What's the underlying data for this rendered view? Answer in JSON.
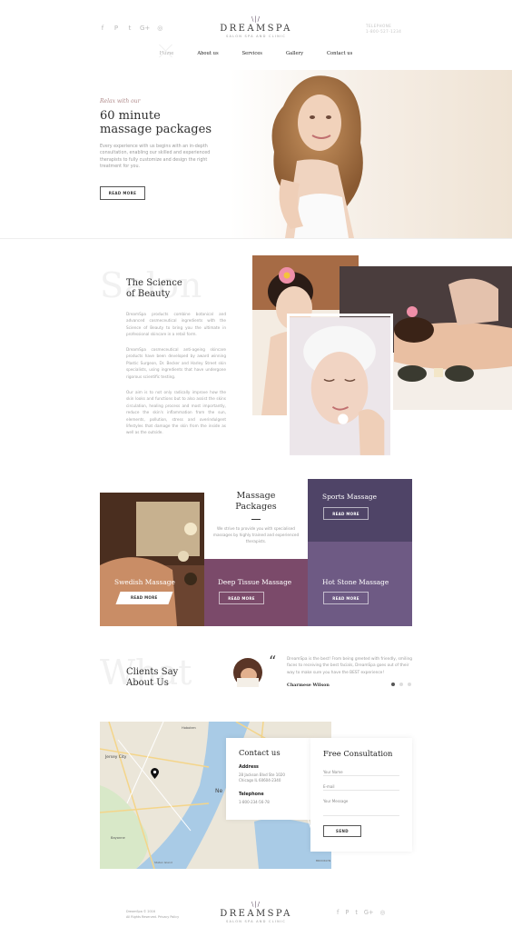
{
  "header": {
    "social": [
      "f",
      "P",
      "t",
      "G+",
      "◎"
    ],
    "logo": {
      "rays": "\\|/",
      "name": "DREAMSPA",
      "tagline": "SALON SPA AND CLINIC"
    },
    "phone": {
      "label": "TELEPHONE",
      "number": "1-800-527-1234"
    }
  },
  "nav": [
    {
      "label": "Home",
      "active": true
    },
    {
      "label": "About us",
      "active": false
    },
    {
      "label": "Services",
      "active": false
    },
    {
      "label": "Gallery",
      "active": false
    },
    {
      "label": "Contact us",
      "active": false
    }
  ],
  "hero": {
    "kicker": "Relax with our",
    "title_line1": "60 minute",
    "title_line2": "massage packages",
    "description": "Every experience with us begins with an in-depth consultation, enabling our skilled and experienced therapists to fully customize and design the right treatment for you.",
    "button": "READ MORE"
  },
  "science": {
    "bg_word": "Salon",
    "title_line1": "The Science",
    "title_line2": "of Beauty",
    "p1": "DreamSpa products combine botanical and advanced cosmeceutical ingredients with the Science of Beauty to bring you the ultimate in professional skincare in a retail form.",
    "p2": "DreamSpa cosmeceutical anti-ageing skincare products have been developed by award winning Plastic Surgeon, Dr. Becker and Harley Street skin specialists, using ingredients that have undergone rigorous scientific testing.",
    "p3": "Our aim is to not only radically improve how the skin looks and functions but to also assist the skins circulation, healing process and most importantly, reduce the skin's inflammation from the sun, elements, pollution, stress and overindulgent lifestyles that damage the skin from the inside as well as the outside."
  },
  "packages": {
    "title_line1": "Massage",
    "title_line2": "Packages",
    "description": "We strive to provide you with specialised massages by highly trained and experienced therapists.",
    "tiles": [
      {
        "name": "Swedish Massage",
        "button": "READ MORE"
      },
      {
        "name": "Sports Massage",
        "button": "READ MORE"
      },
      {
        "name": "Deep Tissue Massage",
        "button": "READ MORE"
      },
      {
        "name": "Hot Stone Massage",
        "button": "READ MORE"
      }
    ]
  },
  "testimonials": {
    "bg_word": "What",
    "title_line1": "Clients Say",
    "title_line2": "About Us",
    "quote_mark": "“",
    "quote": "DreamSpa is the best! From being greeted with friendly, smiling faces to receiving the best facials, DreamSpa goes out of their way to make sure you have the BEST experience!",
    "author": "Charmese Wilson"
  },
  "contact": {
    "title": "Contact us",
    "address_label": "Address",
    "address_line1": "28 Jackson Blvd Ste 1020",
    "address_line2": "Chicago IL 60604-2340",
    "phone_label": "Telephone",
    "phone": "1-800-234-56-78",
    "map_labels": [
      "Jersey City",
      "Hoboken",
      "Ne",
      "Bayonne",
      "BROOKLYN",
      "Staten Island"
    ]
  },
  "consultation": {
    "title": "Free Consultation",
    "name_placeholder": "Your Name",
    "email_placeholder": "E-mail",
    "message_placeholder": "Your Message",
    "send": "SEND"
  },
  "footer": {
    "copyright": "DreamSpa © 2016",
    "links": "All Rights Reserved. Privacy Policy",
    "social": [
      "f",
      "P",
      "t",
      "G+",
      "◎"
    ]
  },
  "colors": {
    "sports": "#4f4467",
    "deep": "#7b4a6a",
    "hot": "#6e5a84",
    "accent": "#b08a8a"
  }
}
